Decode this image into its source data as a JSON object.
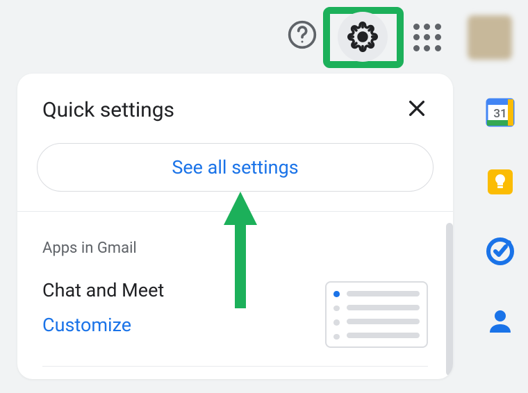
{
  "panel": {
    "title": "Quick settings",
    "see_all": "See all settings",
    "apps_label": "Apps in Gmail",
    "chat_meet": "Chat and Meet",
    "customize": "Customize"
  },
  "sidepanel": {
    "calendar_day": "31"
  },
  "colors": {
    "highlight": "#1cb05a",
    "link": "#1a73e8"
  }
}
